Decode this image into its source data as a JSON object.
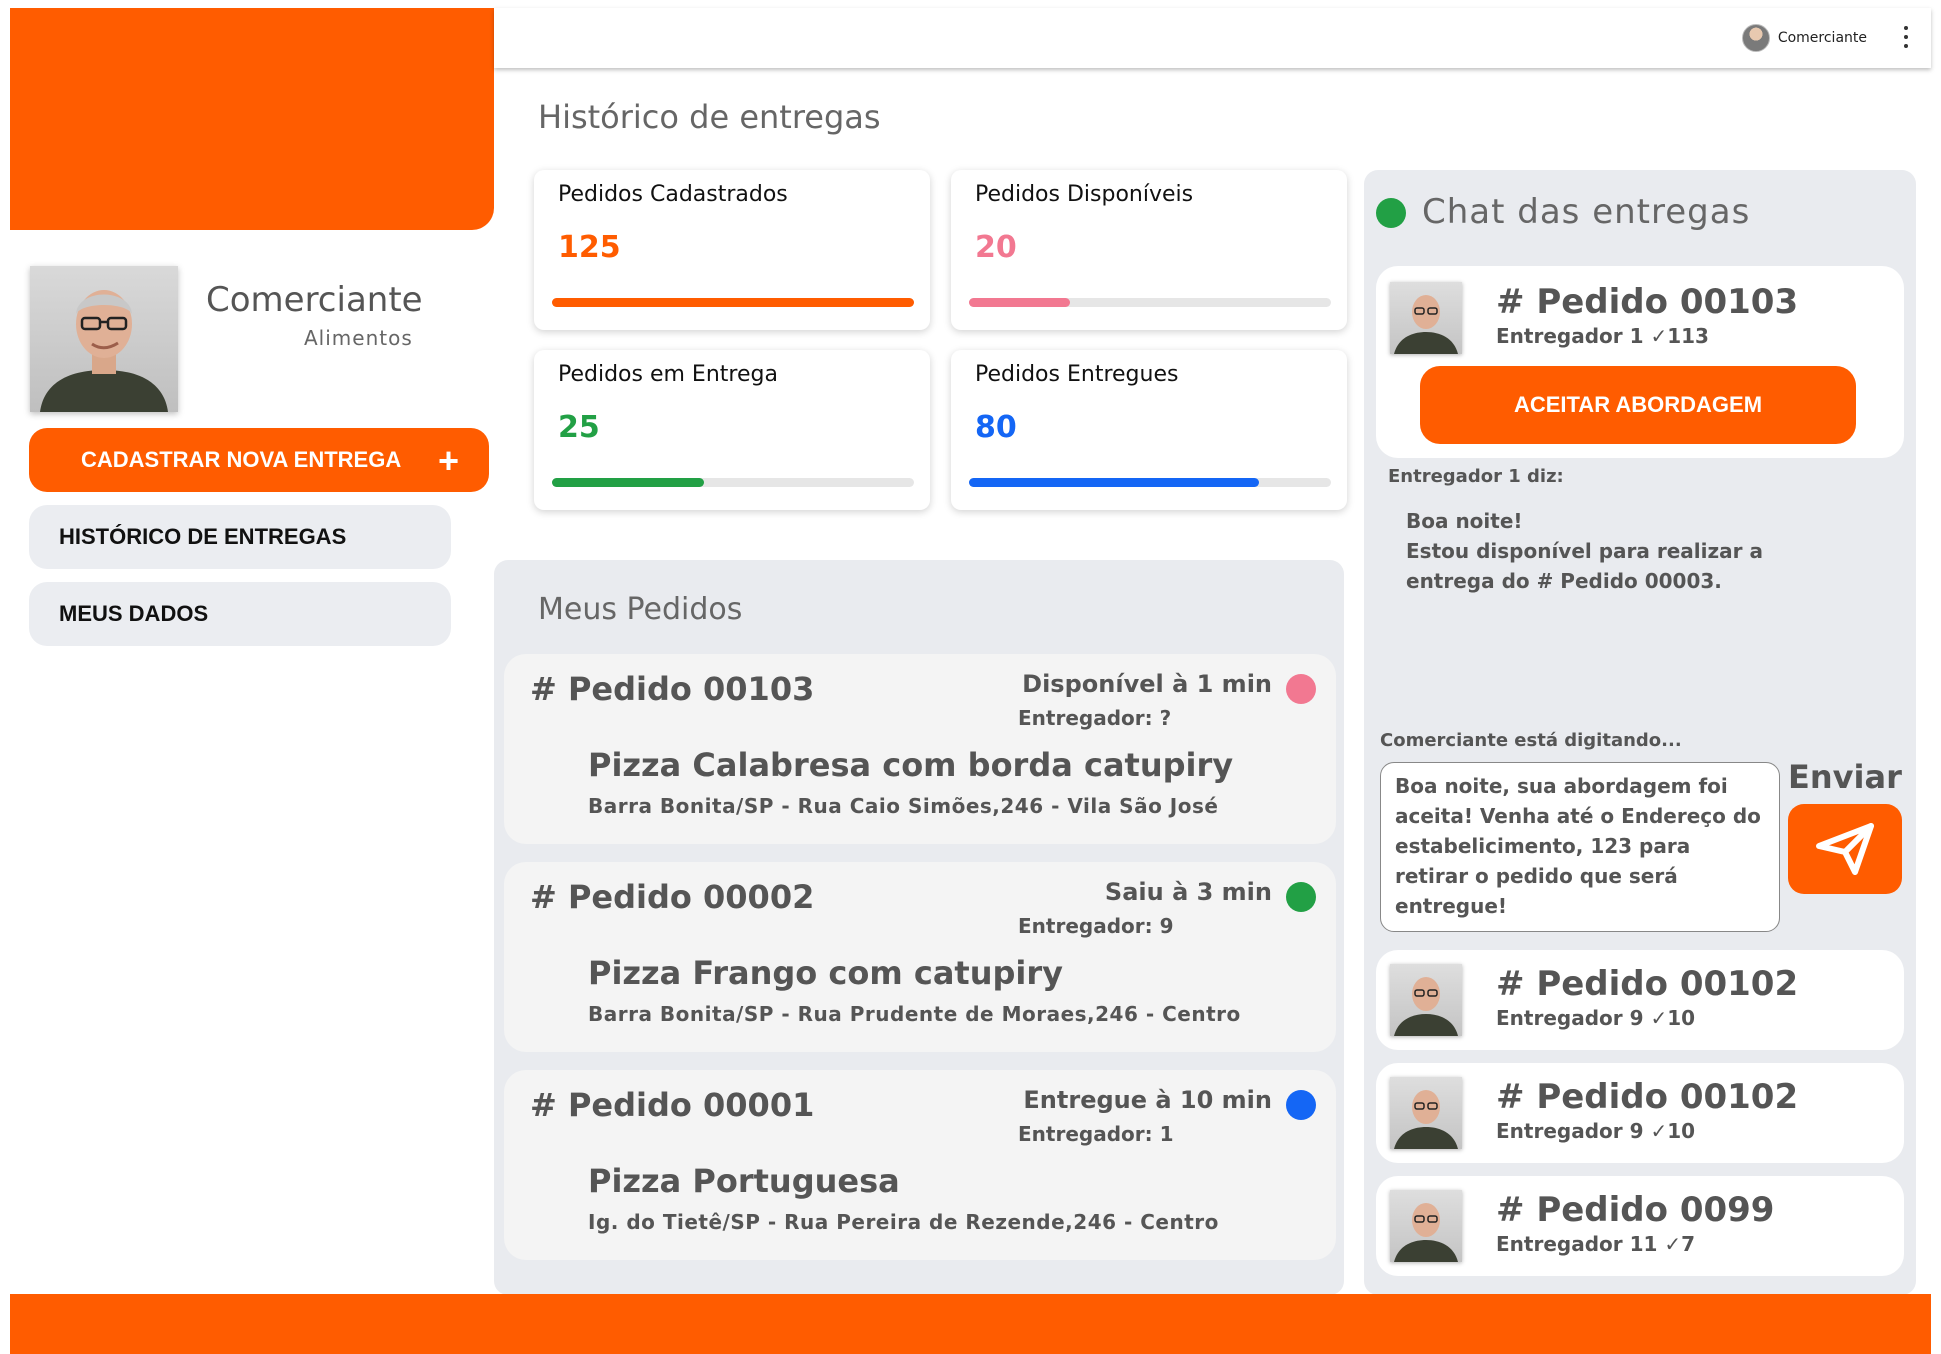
{
  "colors": {
    "accent": "#ff5c00",
    "disponivel": "#f27891",
    "saiu": "#22a045",
    "entregue": "#1466f5",
    "panel": "#e9ebef"
  },
  "topbar": {
    "user_name": "Comerciante"
  },
  "profile": {
    "name": "Comerciante",
    "category": "Alimentos"
  },
  "sidebar": {
    "new_delivery": "CADASTRAR NOVA ENTREGA",
    "new_delivery_icon": "+",
    "history": "HISTÓRICO DE ENTREGAS",
    "my_data": "MEUS DADOS"
  },
  "main": {
    "title": "Histórico de entregas"
  },
  "stats": [
    {
      "label": "Pedidos Cadastrados",
      "value": "125",
      "progress": 1.0,
      "color": "#ff5c00"
    },
    {
      "label": "Pedidos Disponíveis",
      "value": "20",
      "progress": 0.28,
      "color": "#f27891"
    },
    {
      "label": "Pedidos em Entrega",
      "value": "25",
      "progress": 0.42,
      "color": "#22a045"
    },
    {
      "label": "Pedidos Entregues",
      "value": "80",
      "progress": 0.8,
      "color": "#1466f5"
    }
  ],
  "orders_panel": {
    "title": "Meus Pedidos",
    "orders": [
      {
        "id": "# Pedido 00103",
        "status": "Disponível à 1 min",
        "status_color": "#f27891",
        "courier": "Entregador: ?",
        "item": "Pizza Calabresa com borda catupiry",
        "address": "Barra Bonita/SP - Rua Caio Simões,246 - Vila São José"
      },
      {
        "id": "# Pedido 00002",
        "status": "Saiu à 3 min",
        "status_color": "#22a045",
        "courier": "Entregador: 9",
        "item": "Pizza Frango com catupiry",
        "address": "Barra Bonita/SP - Rua Prudente de Moraes,246 - Centro"
      },
      {
        "id": "# Pedido 00001",
        "status": "Entregue à 10 min",
        "status_color": "#1466f5",
        "courier": "Entregador: 1",
        "item": "Pizza Portuguesa",
        "address": "Ig. do Tietê/SP - Rua Pereira de Rezende,246 - Centro"
      }
    ]
  },
  "chat": {
    "title": "Chat das entregas",
    "active": {
      "id": "# Pedido 00103",
      "sub": "Entregador 1 ✓113",
      "accept_label": "ACEITAR ABORDAGEM"
    },
    "says_label": "Entregador 1 diz:",
    "message": "Boa noite!\nEstou disponível para realizar a entrega do # Pedido 00003.",
    "typing_label": "Comerciante está digitando...",
    "reply_text": "Boa noite, sua abordagem foi aceita! Venha até o Endereço do estabelicimento, 123 para retirar o pedido que será entregue!",
    "send_label": "Enviar",
    "others": [
      {
        "id": "# Pedido 00102",
        "sub": "Entregador 9 ✓10"
      },
      {
        "id": "# Pedido 00102",
        "sub": "Entregador 9 ✓10"
      },
      {
        "id": "# Pedido 0099",
        "sub": "Entregador 11 ✓7"
      }
    ]
  }
}
